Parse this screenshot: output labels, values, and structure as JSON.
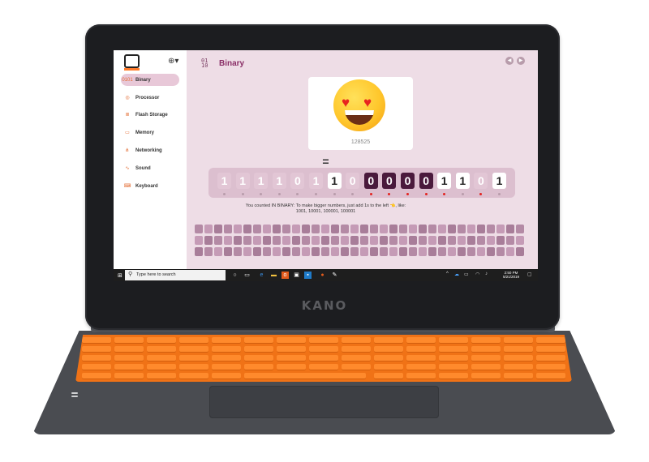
{
  "device": {
    "brand": "KANO"
  },
  "sidebar": {
    "items": [
      {
        "label": "Binary",
        "icon": "0101",
        "active": true
      },
      {
        "label": "Processor",
        "icon": "◎"
      },
      {
        "label": "Flash Storage",
        "icon": "≣"
      },
      {
        "label": "Memory",
        "icon": "▭"
      },
      {
        "label": "Networking",
        "icon": "⋔"
      },
      {
        "label": "Sound",
        "icon": "∿"
      },
      {
        "label": "Keyboard",
        "icon": "⌨"
      }
    ]
  },
  "main": {
    "title": "Binary",
    "icon_top": "01",
    "icon_bottom": "10",
    "number": "128525",
    "equals": "=",
    "bits": [
      "1",
      "1",
      "1",
      "1",
      "0",
      "1",
      "1",
      "0",
      "0",
      "0",
      "0",
      "0",
      "1",
      "1",
      "0",
      "1"
    ],
    "bit_states": [
      "off",
      "off",
      "off",
      "off",
      "off",
      "off",
      "on-white",
      "off",
      "on-dark",
      "on-dark",
      "on-dark",
      "on-dark",
      "on-white",
      "on-white",
      "off",
      "on-white"
    ],
    "dot_states": [
      "gray",
      "gray",
      "gray",
      "gray",
      "gray",
      "gray",
      "gray",
      "gray",
      "red",
      "red",
      "red",
      "red",
      "red",
      "gray",
      "red",
      "gray"
    ],
    "hint_line1": "You counted IN BINARY: To make bigger numbers, just add 1s to the left 👈, like:",
    "hint_line2": "1001, 10001, 100001, 100001"
  },
  "taskbar": {
    "search_placeholder": "Type here to search",
    "time": "2:50 PM",
    "date": "5/21/2019"
  }
}
